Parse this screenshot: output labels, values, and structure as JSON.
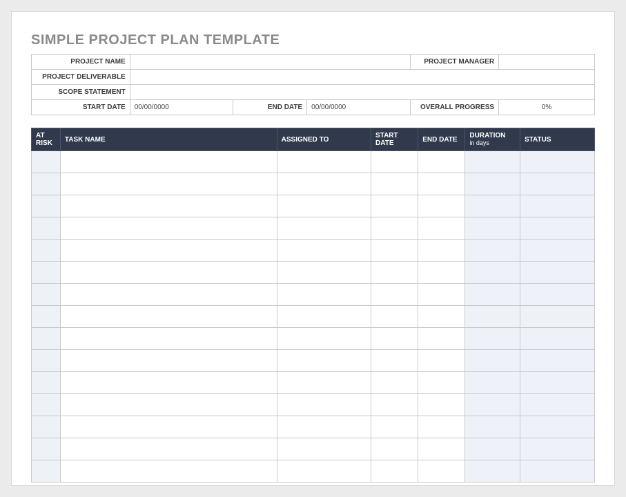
{
  "title": "SIMPLE PROJECT PLAN TEMPLATE",
  "meta": {
    "project_name_label": "PROJECT NAME",
    "project_name": "",
    "project_manager_label": "PROJECT MANAGER",
    "project_manager": "",
    "project_deliverable_label": "PROJECT DELIVERABLE",
    "project_deliverable": "",
    "scope_statement_label": "SCOPE STATEMENT",
    "scope_statement": "",
    "start_date_label": "START DATE",
    "start_date": "00/00/0000",
    "end_date_label": "END DATE",
    "end_date": "00/00/0000",
    "overall_progress_label": "OVERALL PROGRESS",
    "overall_progress": "0%"
  },
  "columns": {
    "at_risk": "AT RISK",
    "task_name": "TASK NAME",
    "assigned_to": "ASSIGNED TO",
    "start_date": "START DATE",
    "end_date": "END DATE",
    "duration": "DURATION",
    "duration_sub": "in days",
    "status": "STATUS"
  },
  "rows": [
    {
      "at_risk": "",
      "task_name": "",
      "assigned_to": "",
      "start_date": "",
      "end_date": "",
      "duration": "",
      "status": ""
    },
    {
      "at_risk": "",
      "task_name": "",
      "assigned_to": "",
      "start_date": "",
      "end_date": "",
      "duration": "",
      "status": ""
    },
    {
      "at_risk": "",
      "task_name": "",
      "assigned_to": "",
      "start_date": "",
      "end_date": "",
      "duration": "",
      "status": ""
    },
    {
      "at_risk": "",
      "task_name": "",
      "assigned_to": "",
      "start_date": "",
      "end_date": "",
      "duration": "",
      "status": ""
    },
    {
      "at_risk": "",
      "task_name": "",
      "assigned_to": "",
      "start_date": "",
      "end_date": "",
      "duration": "",
      "status": ""
    },
    {
      "at_risk": "",
      "task_name": "",
      "assigned_to": "",
      "start_date": "",
      "end_date": "",
      "duration": "",
      "status": ""
    },
    {
      "at_risk": "",
      "task_name": "",
      "assigned_to": "",
      "start_date": "",
      "end_date": "",
      "duration": "",
      "status": ""
    },
    {
      "at_risk": "",
      "task_name": "",
      "assigned_to": "",
      "start_date": "",
      "end_date": "",
      "duration": "",
      "status": ""
    },
    {
      "at_risk": "",
      "task_name": "",
      "assigned_to": "",
      "start_date": "",
      "end_date": "",
      "duration": "",
      "status": ""
    },
    {
      "at_risk": "",
      "task_name": "",
      "assigned_to": "",
      "start_date": "",
      "end_date": "",
      "duration": "",
      "status": ""
    },
    {
      "at_risk": "",
      "task_name": "",
      "assigned_to": "",
      "start_date": "",
      "end_date": "",
      "duration": "",
      "status": ""
    },
    {
      "at_risk": "",
      "task_name": "",
      "assigned_to": "",
      "start_date": "",
      "end_date": "",
      "duration": "",
      "status": ""
    },
    {
      "at_risk": "",
      "task_name": "",
      "assigned_to": "",
      "start_date": "",
      "end_date": "",
      "duration": "",
      "status": ""
    },
    {
      "at_risk": "",
      "task_name": "",
      "assigned_to": "",
      "start_date": "",
      "end_date": "",
      "duration": "",
      "status": ""
    },
    {
      "at_risk": "",
      "task_name": "",
      "assigned_to": "",
      "start_date": "",
      "end_date": "",
      "duration": "",
      "status": ""
    }
  ]
}
